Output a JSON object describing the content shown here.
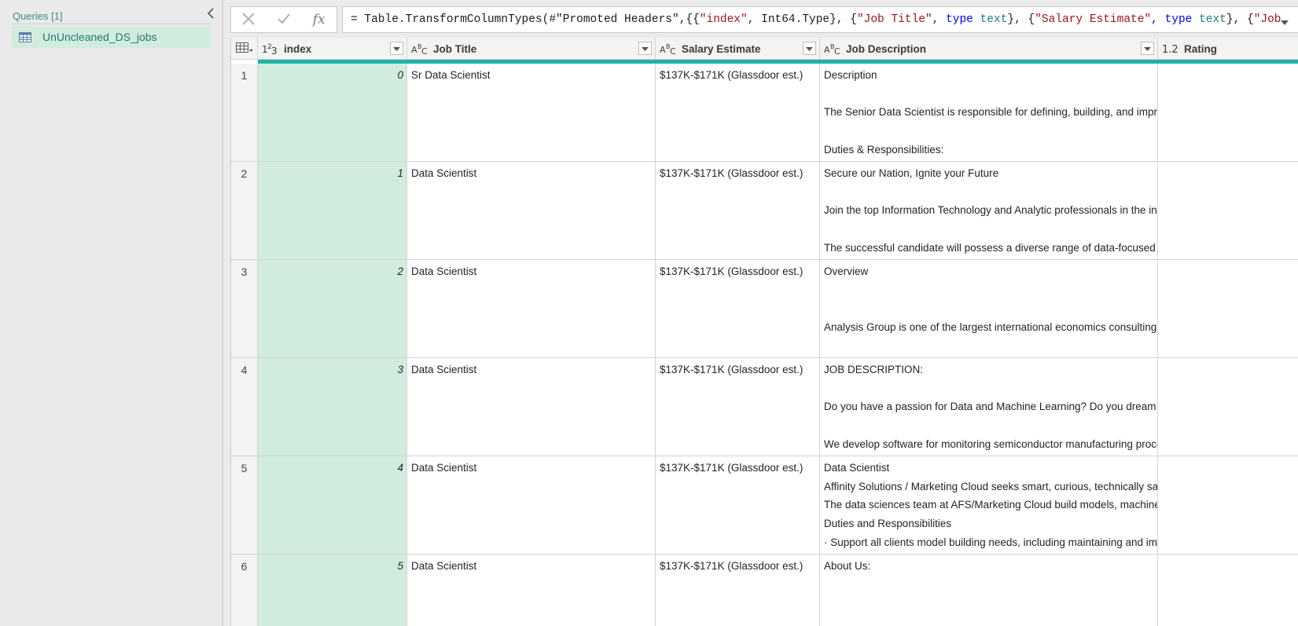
{
  "queries_pane": {
    "header": "Queries [1]",
    "items": [
      {
        "label": "UnUncleaned_DS_jobs",
        "icon": "table-icon"
      }
    ]
  },
  "formula_bar": {
    "cancel_icon": "close-icon",
    "commit_icon": "check-icon",
    "fx_label": "fx",
    "tokens": [
      {
        "t": "= Table.TransformColumnTypes(#",
        "c": "fn"
      },
      {
        "t": "\"Promoted Headers\"",
        "c": "fn"
      },
      {
        "t": ",{{",
        "c": "fn"
      },
      {
        "t": "\"index\"",
        "c": "str"
      },
      {
        "t": ", Int64.Type}, {",
        "c": "fn"
      },
      {
        "t": "\"Job Title\"",
        "c": "str"
      },
      {
        "t": ", ",
        "c": "fn"
      },
      {
        "t": "type",
        "c": "kw"
      },
      {
        "t": " ",
        "c": "fn"
      },
      {
        "t": "text",
        "c": "type"
      },
      {
        "t": "}, {",
        "c": "fn"
      },
      {
        "t": "\"Salary Estimate\"",
        "c": "str"
      },
      {
        "t": ", ",
        "c": "fn"
      },
      {
        "t": "type",
        "c": "kw"
      },
      {
        "t": " ",
        "c": "fn"
      },
      {
        "t": "text",
        "c": "type"
      },
      {
        "t": "}, {",
        "c": "fn"
      },
      {
        "t": "\"Job",
        "c": "str"
      }
    ]
  },
  "grid": {
    "columns": [
      {
        "key": "index",
        "label": "index",
        "type_icon": "1²₃"
      },
      {
        "key": "title",
        "label": "Job Title",
        "type_icon": "AᴮC"
      },
      {
        "key": "salary",
        "label": "Salary Estimate",
        "type_icon": "AᴮC"
      },
      {
        "key": "desc",
        "label": "Job Description",
        "type_icon": "AᴮC"
      },
      {
        "key": "rating",
        "label": "Rating",
        "type_icon": "1.2"
      }
    ],
    "rows": [
      {
        "num": "1",
        "index": "0",
        "title": "Sr Data Scientist",
        "salary": "$137K-$171K (Glassdoor est.)",
        "desc": [
          {
            "line": 0,
            "text": "Description"
          },
          {
            "line": 2,
            "text": "The Senior Data Scientist is responsible for defining, building, and improving"
          },
          {
            "line": 4,
            "text": "Duties & Responsibilities:"
          }
        ]
      },
      {
        "num": "2",
        "index": "1",
        "title": "Data Scientist",
        "salary": "$137K-$171K (Glassdoor est.)",
        "desc": [
          {
            "line": 0,
            "text": "Secure our Nation, Ignite your Future"
          },
          {
            "line": 2,
            "text": "Join the top Information Technology and Analytic professionals in the industry"
          },
          {
            "line": 4,
            "text": "The successful candidate will possess a diverse range of data-focused skills"
          }
        ]
      },
      {
        "num": "3",
        "index": "2",
        "title": "Data Scientist",
        "salary": "$137K-$171K (Glassdoor est.)",
        "desc": [
          {
            "line": 0,
            "text": "Overview"
          },
          {
            "line": 3,
            "text": "Analysis Group is one of the largest international economics consulting firms"
          }
        ]
      },
      {
        "num": "4",
        "index": "3",
        "title": "Data Scientist",
        "salary": "$137K-$171K (Glassdoor est.)",
        "desc": [
          {
            "line": 0,
            "text": "JOB DESCRIPTION:"
          },
          {
            "line": 2,
            "text": "Do you have a passion for Data and Machine Learning? Do you dream of working"
          },
          {
            "line": 4,
            "text": "We develop software for monitoring semiconductor manufacturing processes"
          }
        ]
      },
      {
        "num": "5",
        "index": "4",
        "title": "Data Scientist",
        "salary": "$137K-$171K (Glassdoor est.)",
        "desc": [
          {
            "line": 0,
            "text": "Data Scientist"
          },
          {
            "line": 1,
            "text": "Affinity Solutions / Marketing Cloud seeks smart, curious, technically savvy"
          },
          {
            "line": 2,
            "text": "The data sciences team at AFS/Marketing Cloud build models, machine learning"
          },
          {
            "line": 3,
            "text": "Duties and Responsibilities"
          },
          {
            "line": 4,
            "text": "· Support all clients model building needs, including maintaining and improving"
          }
        ]
      },
      {
        "num": "6",
        "index": "5",
        "title": "Data Scientist",
        "salary": "$137K-$171K (Glassdoor est.)",
        "desc": [
          {
            "line": 0,
            "text": "About Us:"
          }
        ]
      }
    ]
  },
  "colors": {
    "accent": "#1fb3a7",
    "selected_column": "#d1ecdf",
    "query_text": "#1f7a6e"
  }
}
